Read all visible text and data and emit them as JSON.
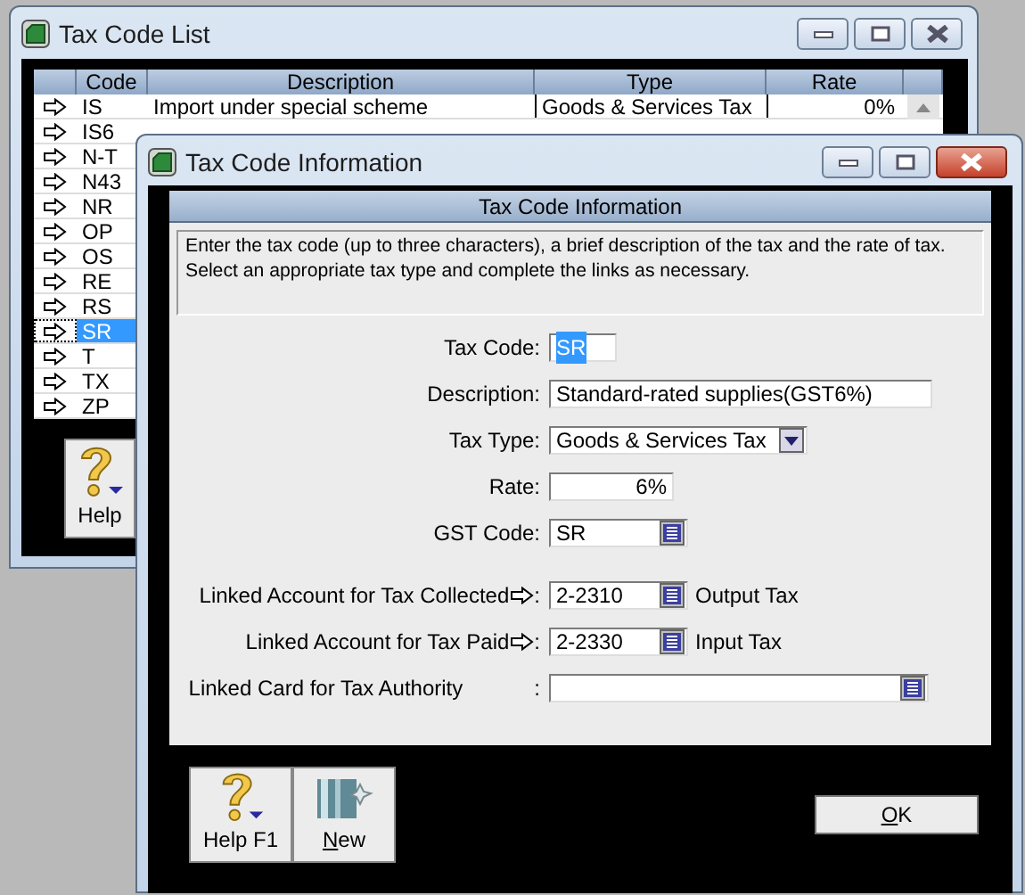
{
  "list_window": {
    "title": "Tax Code List",
    "columns": [
      "Code",
      "Description",
      "Type",
      "Rate"
    ],
    "rows": [
      {
        "code": "IS",
        "description": "Import under special scheme",
        "type": "Goods & Services Tax",
        "rate": "0%",
        "selected": false
      },
      {
        "code": "IS6",
        "selected": false
      },
      {
        "code": "N-T",
        "selected": false
      },
      {
        "code": "N43",
        "selected": false
      },
      {
        "code": "NR",
        "selected": false
      },
      {
        "code": "OP",
        "selected": false
      },
      {
        "code": "OS",
        "selected": false
      },
      {
        "code": "RE",
        "selected": false
      },
      {
        "code": "RS",
        "selected": false
      },
      {
        "code": "SR",
        "selected": true
      },
      {
        "code": "T",
        "selected": false
      },
      {
        "code": "TX",
        "selected": false
      },
      {
        "code": "ZP",
        "selected": false
      }
    ],
    "help_button": "Help"
  },
  "dialog": {
    "title": "Tax Code Information",
    "panel_title": "Tax Code Information",
    "instructions": "Enter the tax code (up to three characters), a brief description of the tax and the rate of tax. Select an appropriate tax type and complete the links as necessary.",
    "fields": [
      {
        "kind": "code",
        "label": "Tax Code:",
        "value": "SR",
        "focused": true,
        "arrow": false
      },
      {
        "kind": "text",
        "label": "Description:",
        "value": "Standard-rated supplies(GST6%)",
        "focused": false,
        "arrow": false
      },
      {
        "kind": "select",
        "label": "Tax Type:",
        "value": "Goods & Services Tax",
        "focused": false,
        "arrow": false
      },
      {
        "kind": "number",
        "label": "Rate:",
        "value": "6%",
        "focused": false,
        "arrow": false
      },
      {
        "kind": "lookup",
        "label": "GST Code:",
        "value": "SR",
        "focused": false,
        "arrow": false
      }
    ],
    "links": [
      {
        "kind": "lookup",
        "label": "Linked Account for Tax Collected",
        "separator": ":",
        "value": "2-2310",
        "suffix": "Output Tax",
        "focused": false,
        "arrow": true
      },
      {
        "kind": "lookup",
        "label": "Linked Account for Tax Paid",
        "separator": ":",
        "value": "2-2330",
        "suffix": "Input Tax",
        "focused": false,
        "arrow": true
      },
      {
        "kind": "lookup_long",
        "label": "Linked Card for Tax Authority",
        "separator": ":",
        "focused": false,
        "arrow": false
      }
    ],
    "tools": [
      {
        "kind": "help",
        "label": "Help F1"
      },
      {
        "kind": "new",
        "label": "New",
        "access_key": true
      }
    ],
    "ok_button": {
      "label": "OK",
      "access_key": true
    }
  }
}
